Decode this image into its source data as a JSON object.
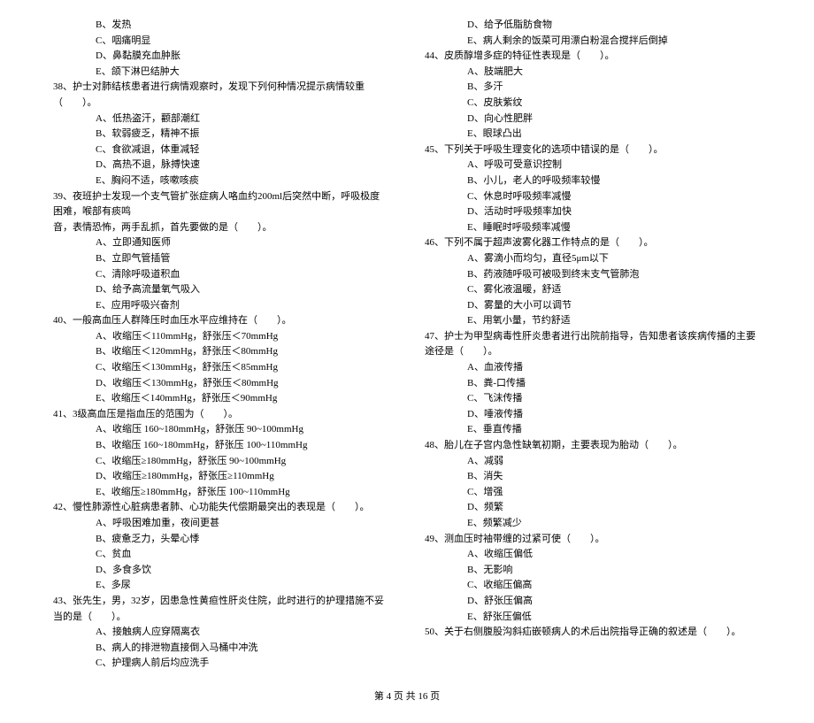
{
  "left": {
    "pre_options": [
      "B、发热",
      "C、咽痛明显",
      "D、鼻黏膜充血肿胀",
      "E、颌下淋巴结肿大"
    ],
    "q38": {
      "stem": "38、护士对肺结核患者进行病情观察时，发现下列何种情况提示病情较重（　　）。",
      "opts": [
        "A、低热盗汗，颧部潮红",
        "B、软弱疲乏，精神不振",
        "C、食欲减退，体重减轻",
        "D、高热不退，脉搏快速",
        "E、胸闷不适，咳嗽咳痰"
      ]
    },
    "q39": {
      "stem": "39、夜班护士发现一个支气管扩张症病人咯血约200ml后突然中断，呼吸极度困难，喉部有痰鸣",
      "cont": "音，表情恐怖，两手乱抓，首先要做的是（　　）。",
      "opts": [
        "A、立即通知医师",
        "B、立即气管插管",
        "C、清除呼吸道积血",
        "D、给予高流量氧气吸入",
        "E、应用呼吸兴奋剂"
      ]
    },
    "q40": {
      "stem": "40、一般高血压人群降压时血压水平应维持在（　　）。",
      "opts": [
        "A、收缩压＜110mmHg，舒张压＜70mmHg",
        "B、收缩压＜120mmHg，舒张压＜80mmHg",
        "C、收缩压＜130mmHg，舒张压＜85mmHg",
        "D、收缩压＜130mmHg，舒张压＜80mmHg",
        "E、收缩压＜140mmHg，舒张压＜90mmHg"
      ]
    },
    "q41": {
      "stem": "41、3级高血压是指血压的范围为（　　）。",
      "opts": [
        "A、收缩压 160~180mmHg，舒张压 90~100mmHg",
        "B、收缩压 160~180mmHg，舒张压 100~110mmHg",
        "C、收缩压≥180mmHg，舒张压 90~100mmHg",
        "D、收缩压≥180mmHg，舒张压≥110mmHg",
        "E、收缩压≥180mmHg，舒张压 100~110mmHg"
      ]
    },
    "q42": {
      "stem": "42、慢性肺源性心脏病患者肺、心功能失代偿期最突出的表现是（　　）。",
      "opts": [
        "A、呼吸困难加重，夜间更甚",
        "B、疲惫乏力，头晕心悸",
        "C、贫血",
        "D、多食多饮",
        "E、多尿"
      ]
    },
    "q43": {
      "stem": "43、张先生，男，32岁，因患急性黄疸性肝炎住院，此时进行的护理措施不妥当的是（　　）。",
      "opts": [
        "A、接触病人应穿隔离衣",
        "B、病人的排泄物直接倒入马桶中冲洗",
        "C、护理病人前后均应洗手"
      ]
    }
  },
  "right": {
    "pre_options": [
      "D、给予低脂肪食物",
      "E、病人剩余的饭菜可用漂白粉混合搅拌后倒掉"
    ],
    "q44": {
      "stem": "44、皮质醇增多症的特征性表现是（　　）。",
      "opts": [
        "A、肢端肥大",
        "B、多汗",
        "C、皮肤紫纹",
        "D、向心性肥胖",
        "E、眼球凸出"
      ]
    },
    "q45": {
      "stem": "45、下列关于呼吸生理变化的选项中错误的是（　　）。",
      "opts": [
        "A、呼吸可受意识控制",
        "B、小儿，老人的呼吸频率较慢",
        "C、休息时呼吸频率减慢",
        "D、活动时呼吸频率加快",
        "E、睡眠时呼吸频率减慢"
      ]
    },
    "q46": {
      "stem": "46、下列不属于超声波雾化器工作特点的是（　　）。",
      "opts": [
        "A、雾滴小而均匀，直径5μm以下",
        "B、药液随呼吸可被吸到终末支气管肺泡",
        "C、雾化液温暖，舒适",
        "D、雾量的大小可以调节",
        "E、用氧小量，节约舒适"
      ]
    },
    "q47": {
      "stem": "47、护士为甲型病毒性肝炎患者进行出院前指导，告知患者该疾病传播的主要途径是（　　）。",
      "opts": [
        "A、血液传播",
        "B、粪-口传播",
        "C、飞沫传播",
        "D、唾液传播",
        "E、垂直传播"
      ]
    },
    "q48": {
      "stem": "48、胎儿在子宫内急性缺氧初期，主要表现为胎动（　　）。",
      "opts": [
        "A、减弱",
        "B、消失",
        "C、增强",
        "D、频繁",
        "E、频繁减少"
      ]
    },
    "q49": {
      "stem": "49、测血压时袖带缠的过紧可使（　　）。",
      "opts": [
        "A、收缩压偏低",
        "B、无影响",
        "C、收缩压偏高",
        "D、舒张压偏高",
        "E、舒张压偏低"
      ]
    },
    "q50": {
      "stem": "50、关于右侧腹股沟斜疝嵌顿病人的术后出院指导正确的叙述是（　　）。"
    }
  },
  "footer": "第 4 页 共 16 页"
}
